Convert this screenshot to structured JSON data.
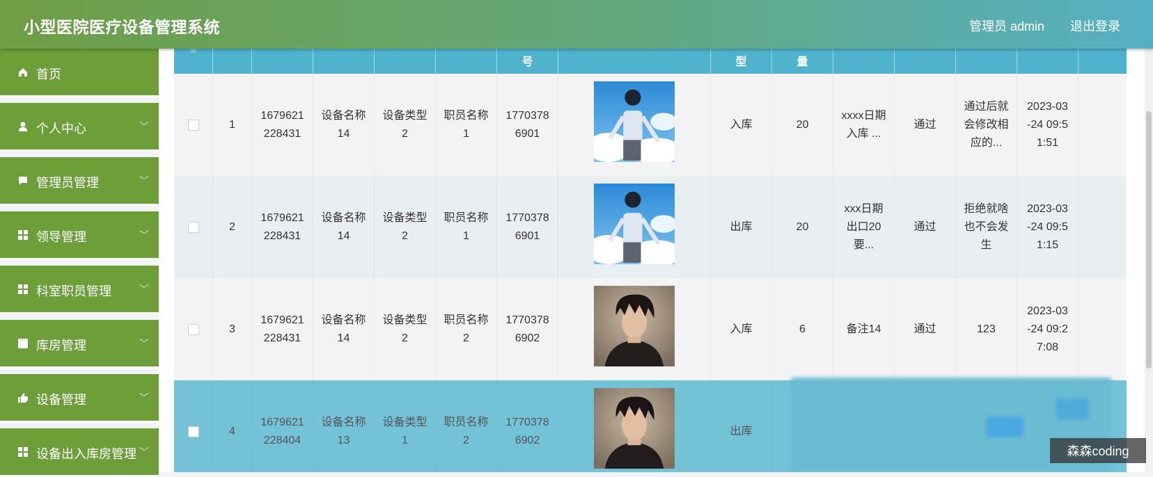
{
  "header": {
    "title": "小型医院医疗设备管理系统",
    "user": "管理员 admin",
    "logout": "退出登录"
  },
  "sidebar": {
    "items": [
      {
        "label": "首页",
        "icon": "home-icon",
        "has_sub": false
      },
      {
        "label": "个人中心",
        "icon": "person-icon",
        "has_sub": true
      },
      {
        "label": "管理员管理",
        "icon": "chat-icon",
        "has_sub": true
      },
      {
        "label": "领导管理",
        "icon": "grid-icon",
        "has_sub": true
      },
      {
        "label": "科室职员管理",
        "icon": "grid-icon",
        "has_sub": true
      },
      {
        "label": "库房管理",
        "icon": "box-icon",
        "has_sub": true
      },
      {
        "label": "设备管理",
        "icon": "thumb-icon",
        "has_sub": true
      },
      {
        "label": "设备出入库房管理",
        "icon": "grid-icon",
        "has_sub": true
      }
    ]
  },
  "table": {
    "headers": {
      "select": "",
      "no": "",
      "code": "",
      "name": "",
      "type": "",
      "staff": "",
      "phone": "号",
      "photo": "",
      "io": "型",
      "qty": "量",
      "remark": "",
      "status": "",
      "reply": "",
      "time": ""
    },
    "rows": [
      {
        "no": "1",
        "code": "1679621\n228431",
        "name": "设备名称\n14",
        "type": "设备类型\n2",
        "staff": "职员名称\n1",
        "phone": "1770378\n6901",
        "photo": "boy-sky",
        "io": "入库",
        "qty": "20",
        "remark": "xxxx日期\n入库 ...",
        "status": "通过",
        "reply": "通过后就\n会修改相\n应的...",
        "time": "2023-03\n-24 09:5\n1:51"
      },
      {
        "no": "2",
        "code": "1679621\n228431",
        "name": "设备名称\n14",
        "type": "设备类型\n2",
        "staff": "职员名称\n1",
        "phone": "1770378\n6901",
        "photo": "boy-sky",
        "io": "出库",
        "qty": "20",
        "remark": "xxx日期\n出口20\n要...",
        "status": "通过",
        "reply": "拒绝就啥\n也不会发\n生",
        "time": "2023-03\n-24 09:5\n1:15"
      },
      {
        "no": "3",
        "code": "1679621\n228431",
        "name": "设备名称\n14",
        "type": "设备类型\n2",
        "staff": "职员名称\n2",
        "phone": "1770378\n6902",
        "photo": "man-portrait",
        "io": "入库",
        "qty": "6",
        "remark": "备注14",
        "status": "通过",
        "reply": "123",
        "time": "2023-03\n-24 09:2\n7:08"
      },
      {
        "no": "4",
        "code": "1679621\n228404",
        "name": "设备名称\n13",
        "type": "设备类型\n1",
        "staff": "职员名称\n2",
        "phone": "1770378\n6902",
        "photo": "man-portrait",
        "io": "出库",
        "qty": "",
        "remark": "",
        "status": "",
        "reply": "",
        "time": ""
      }
    ]
  },
  "watermark": "森森coding"
}
